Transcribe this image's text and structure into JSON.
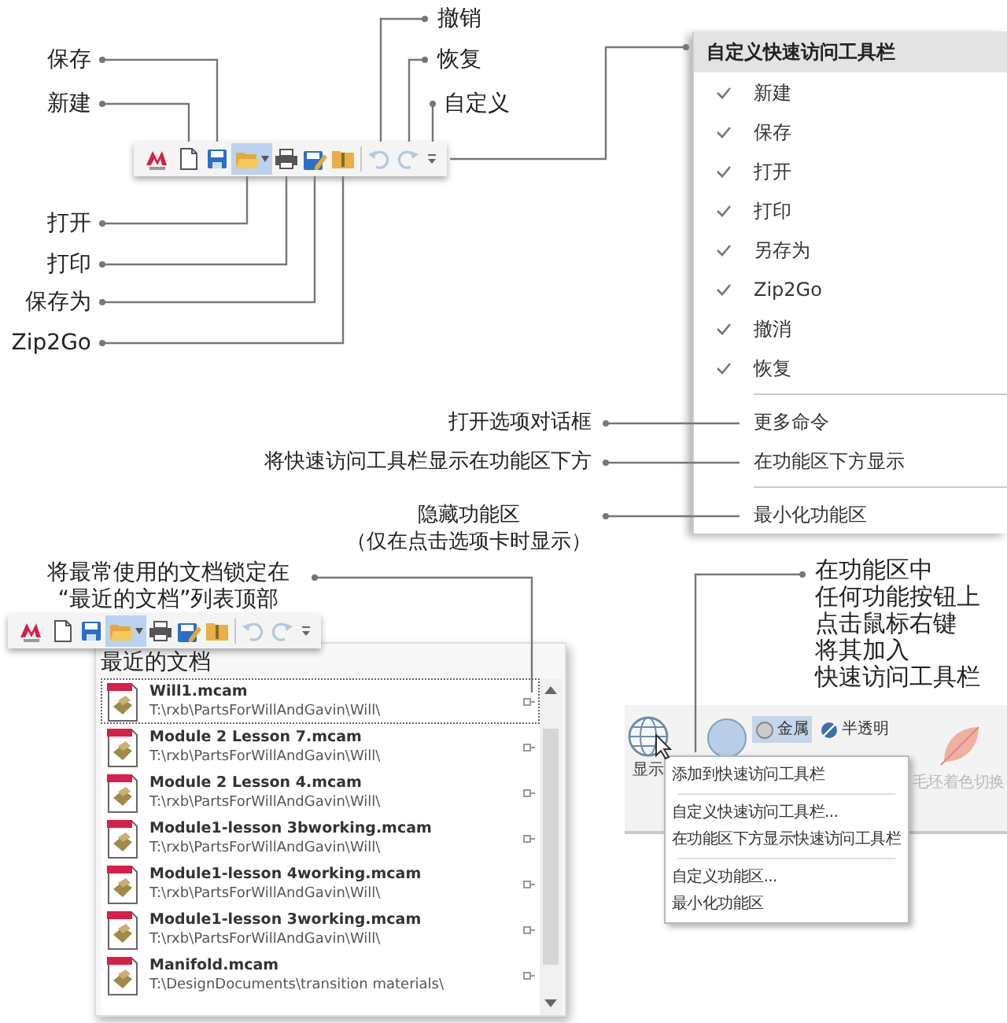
{
  "toolbar": {
    "buttons": [
      {
        "kind": "logo",
        "highlighted": false
      },
      {
        "kind": "new",
        "highlighted": false
      },
      {
        "kind": "save",
        "highlighted": false
      },
      {
        "kind": "open",
        "highlighted": true
      },
      {
        "kind": "print",
        "highlighted": false
      },
      {
        "kind": "save_as",
        "highlighted": false
      },
      {
        "kind": "zip",
        "highlighted": false
      },
      {
        "kind": "separator"
      },
      {
        "kind": "undo",
        "highlighted": false,
        "disabled": true
      },
      {
        "kind": "redo",
        "highlighted": false,
        "disabled": true
      },
      {
        "kind": "more",
        "highlighted": false
      }
    ]
  },
  "toolbar_callouts": [
    {
      "text": "保存"
    },
    {
      "text": "新建"
    },
    {
      "text": "打开"
    },
    {
      "text": "打印"
    },
    {
      "text": "保存为"
    },
    {
      "text": "Zip2Go"
    },
    {
      "text": "撤销"
    },
    {
      "text": "恢复"
    },
    {
      "text": "自定义"
    }
  ],
  "customize_menu": {
    "title": "自定义快速访问工具栏",
    "items": [
      {
        "kind": "check",
        "label": "新建",
        "checked": true
      },
      {
        "kind": "check",
        "label": "保存",
        "checked": true
      },
      {
        "kind": "check",
        "label": "打开",
        "checked": true
      },
      {
        "kind": "check",
        "label": "打印",
        "checked": true
      },
      {
        "kind": "check",
        "label": "另存为",
        "checked": true
      },
      {
        "kind": "check",
        "label": "Zip2Go",
        "checked": true
      },
      {
        "kind": "check",
        "label": "撤消",
        "checked": true
      },
      {
        "kind": "check",
        "label": "恢复",
        "checked": true
      },
      {
        "kind": "separator"
      },
      {
        "kind": "command",
        "label": "更多命令"
      },
      {
        "kind": "command",
        "label": "在功能区下方显示"
      },
      {
        "kind": "separator"
      },
      {
        "kind": "command",
        "label": "最小化功能区"
      }
    ]
  },
  "menu_callouts": [
    {
      "lines": [
        "打开选项对话框"
      ]
    },
    {
      "lines": [
        "将快速访问工具栏显示在功能区下方"
      ]
    },
    {
      "lines": [
        "隐藏功能区",
        "（仅在点击选项卡时显示）"
      ]
    }
  ],
  "recent_callout": {
    "lines": [
      "将最常使用的文档锁定在",
      "“最近的文档”列表顶部"
    ]
  },
  "recent_toolbar": {
    "buttons": [
      {
        "kind": "logo",
        "highlighted": false
      },
      {
        "kind": "new",
        "highlighted": false
      },
      {
        "kind": "save",
        "highlighted": false
      },
      {
        "kind": "open",
        "highlighted": true
      },
      {
        "kind": "print",
        "highlighted": false
      },
      {
        "kind": "save_as",
        "highlighted": false
      },
      {
        "kind": "zip",
        "highlighted": false
      },
      {
        "kind": "separator"
      },
      {
        "kind": "undo",
        "highlighted": false,
        "disabled": true
      },
      {
        "kind": "redo",
        "highlighted": false,
        "disabled": true
      },
      {
        "kind": "more",
        "highlighted": false
      }
    ]
  },
  "recent_documents": {
    "title": "最近的文档",
    "files": [
      {
        "name": "Will1.mcam",
        "path": "T:\\rxb\\PartsForWillAndGavin\\Will\\",
        "selected": true
      },
      {
        "name": "Module 2 Lesson 7.mcam",
        "path": "T:\\rxb\\PartsForWillAndGavin\\Will\\",
        "selected": false
      },
      {
        "name": "Module 2 Lesson 4.mcam",
        "path": "T:\\rxb\\PartsForWillAndGavin\\Will\\",
        "selected": false
      },
      {
        "name": "Module1-lesson 3bworking.mcam",
        "path": "T:\\rxb\\PartsForWillAndGavin\\Will\\",
        "selected": false
      },
      {
        "name": "Module1-lesson 4working.mcam",
        "path": "T:\\rxb\\PartsForWillAndGavin\\Will\\",
        "selected": false
      },
      {
        "name": "Module1-lesson 3working.mcam",
        "path": "T:\\rxb\\PartsForWillAndGavin\\Will\\",
        "selected": false
      },
      {
        "name": "Manifold.mcam",
        "path": "T:\\DesignDocuments\\transition materials\\",
        "selected": false
      }
    ]
  },
  "ribbon_callout": {
    "lines": [
      "在功能区中",
      "任何功能按钮上",
      "点击鼠标右键",
      "将其加入",
      "快速访问工具栏"
    ]
  },
  "ribbon": {
    "display_label": "显示",
    "styles": [
      {
        "label": "金属",
        "selected": true
      },
      {
        "label": "半透明",
        "selected": false
      }
    ],
    "faded_label": "毛坯着色切换"
  },
  "context_menu": {
    "items": [
      {
        "kind": "command",
        "label": "添加到快速访问工具栏"
      },
      {
        "kind": "separator"
      },
      {
        "kind": "command",
        "label": "自定义快速访问工具栏..."
      },
      {
        "kind": "command",
        "label": "在功能区下方显示快速访问工具栏"
      },
      {
        "kind": "separator"
      },
      {
        "kind": "command",
        "label": "自定义功能区..."
      },
      {
        "kind": "command",
        "label": "最小化功能区"
      }
    ]
  }
}
